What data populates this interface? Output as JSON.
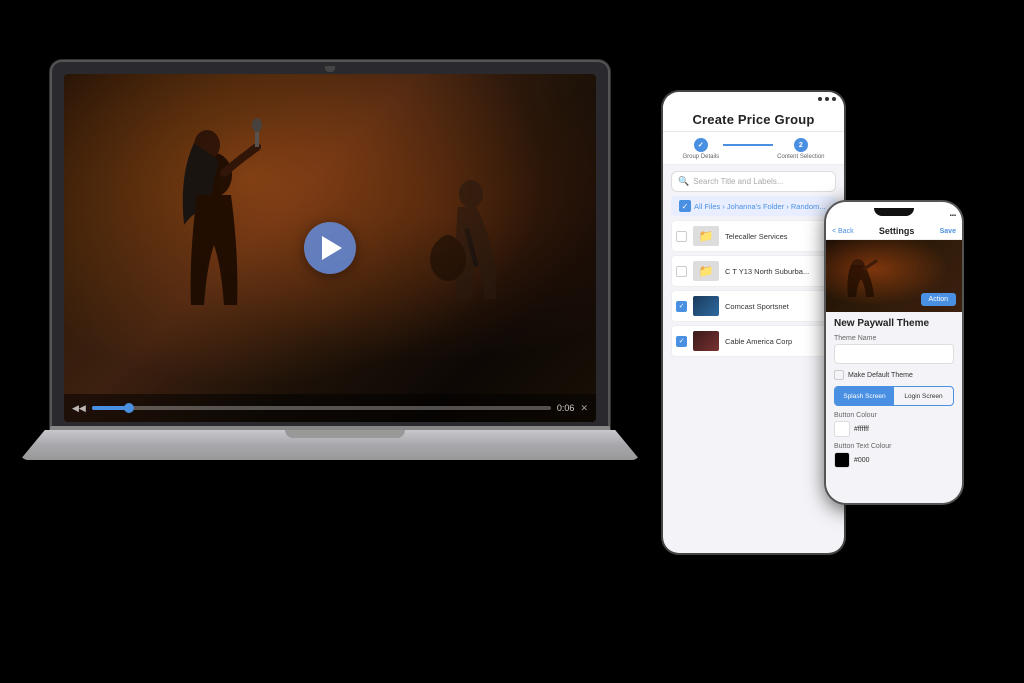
{
  "scene": {
    "background": "#000000"
  },
  "laptop": {
    "video": {
      "play_button_visible": true
    },
    "controls": {
      "time": "0:06",
      "progress_percent": 8
    }
  },
  "tablet": {
    "title": "Create Price Group",
    "steps": [
      {
        "label": "Group Details",
        "state": "done",
        "number": "1"
      },
      {
        "label": "Content Selection",
        "state": "active",
        "number": "2"
      }
    ],
    "search_placeholder": "Search Title and Labels...",
    "breadcrumb": "All Files › Johanna's Folder › Random...",
    "files": [
      {
        "name": "Telecaller Services",
        "type": "folder",
        "checked": false
      },
      {
        "name": "C T Y13 North Suburba...",
        "type": "folder",
        "checked": false
      },
      {
        "name": "Comcast Sportsnet",
        "type": "video",
        "checked": true
      },
      {
        "name": "Cable America Corp",
        "type": "video",
        "checked": true
      }
    ]
  },
  "phone": {
    "title": "Settings",
    "back_label": "< Back",
    "save_label": "Save",
    "section_title": "New Paywall Theme",
    "theme_name_label": "Theme Name",
    "theme_name_value": "",
    "make_default_label": "Make Default Theme",
    "tabs": [
      "Splash Screen",
      "Login Screen"
    ],
    "active_tab": 0,
    "button_colour_label": "Button Colour",
    "button_colour_value": "#ffffff",
    "button_text_label": "Button Text Colour",
    "button_text_value": "#000"
  }
}
